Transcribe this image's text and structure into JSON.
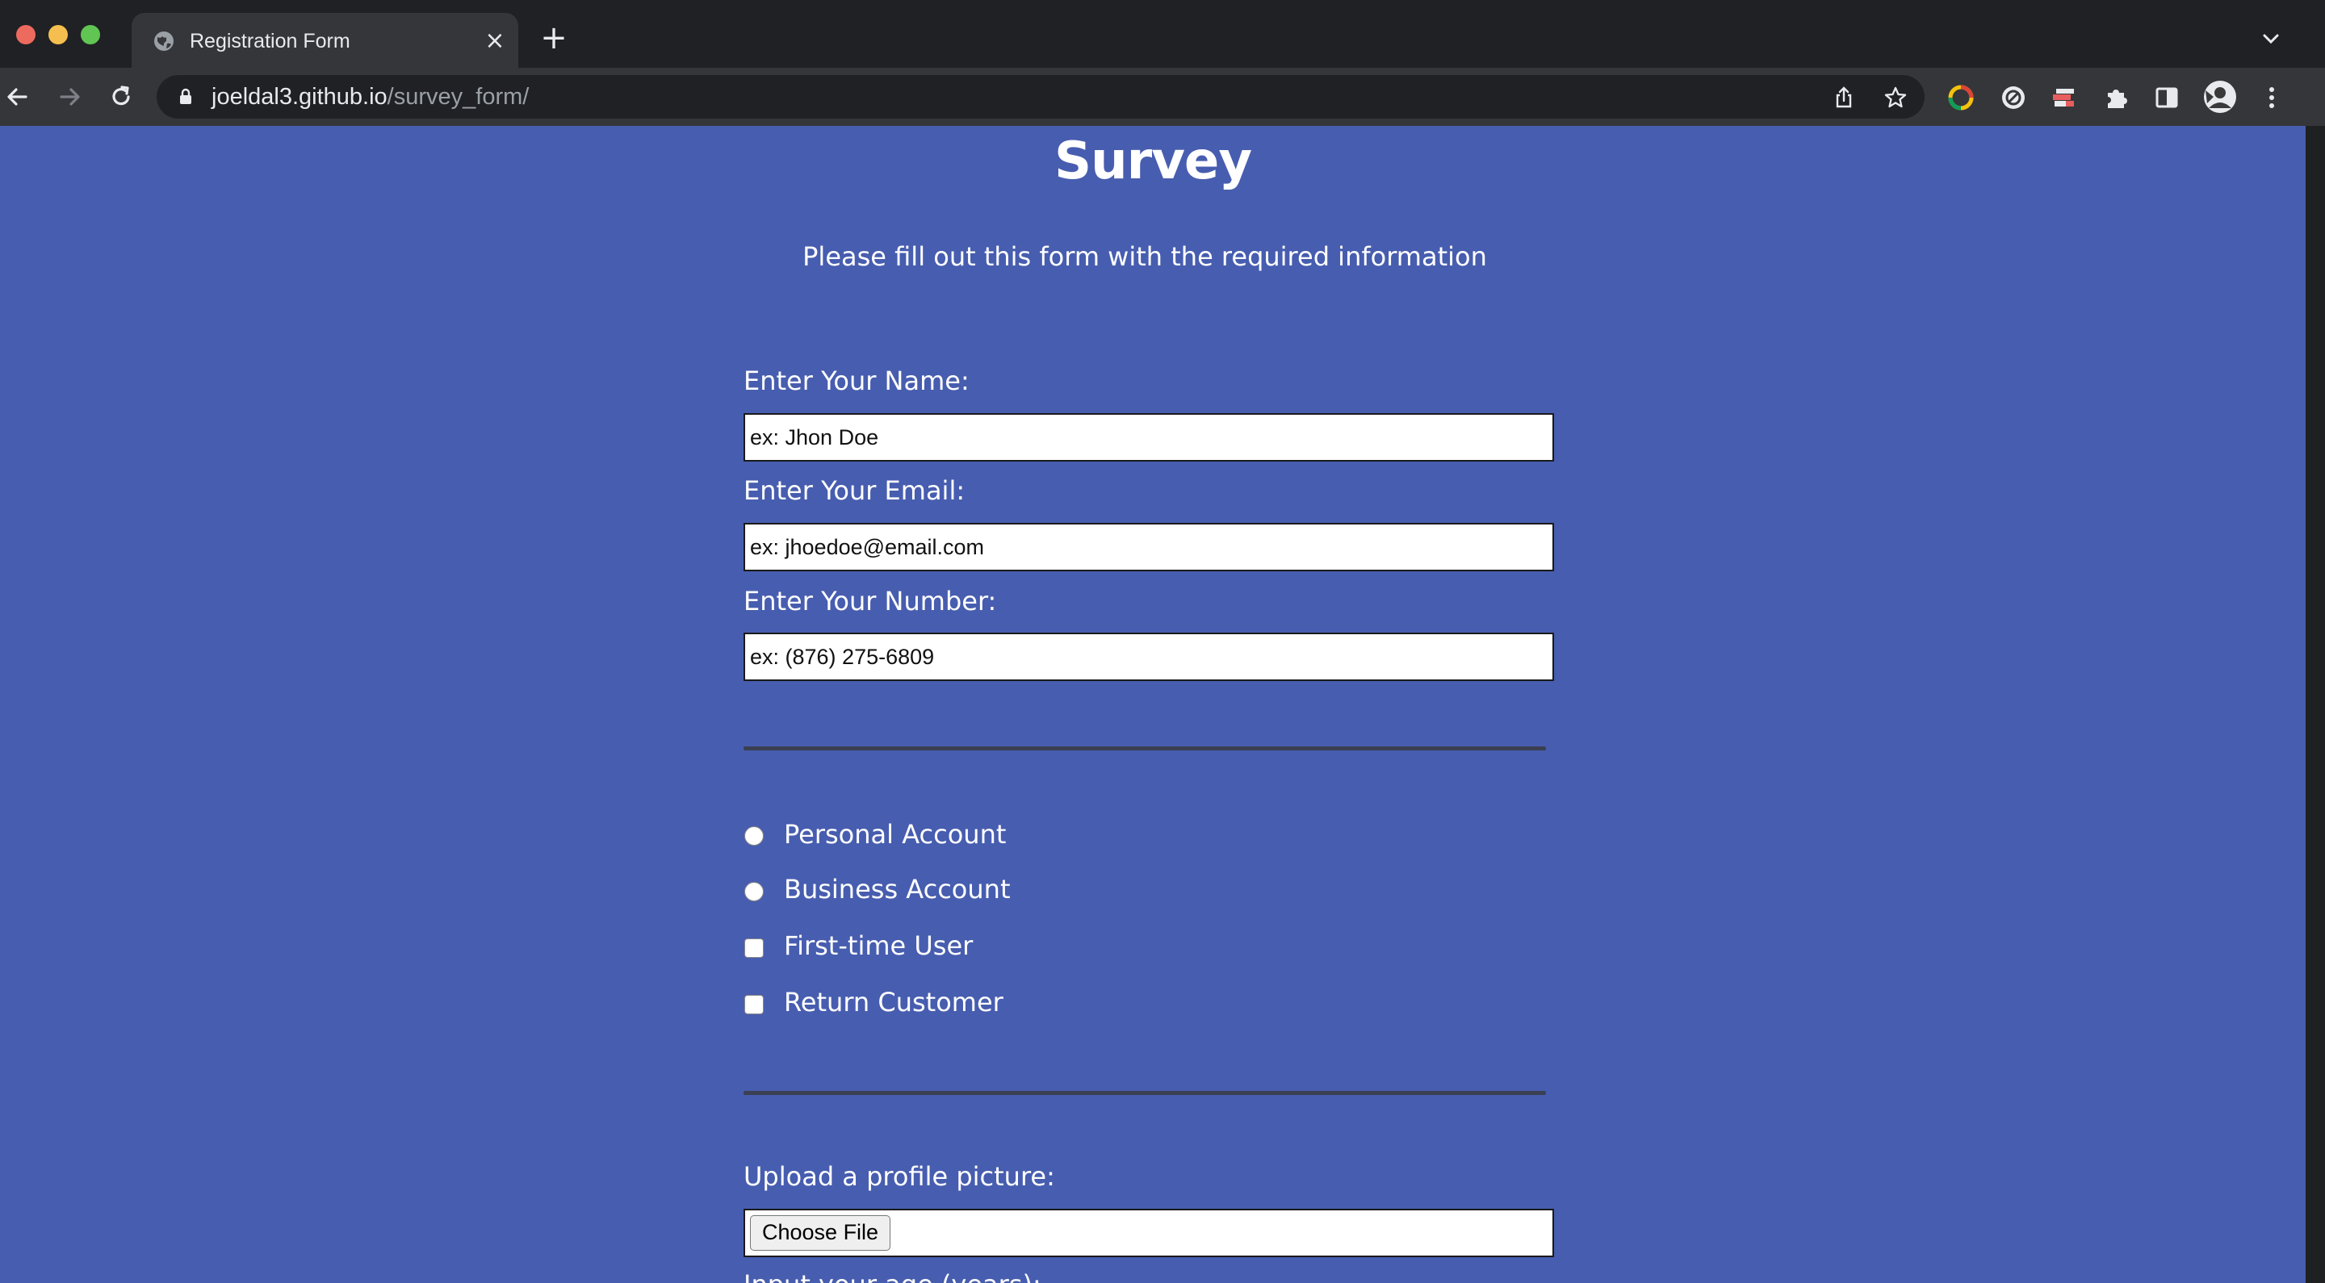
{
  "browser": {
    "tab_title": "Registration Form",
    "tab_close": "×",
    "new_tab": "+",
    "url_host": "joeldal3.github.io",
    "url_path": "/survey_form/"
  },
  "page": {
    "title": "Survey",
    "subtitle": "Please fill out this form with the required information",
    "name_label": "Enter Your Name:",
    "name_placeholder": "ex: Jhon Doe",
    "email_label": "Enter Your Email:",
    "email_placeholder": "ex: jhoedoe@email.com",
    "number_label": "Enter Your Number:",
    "number_placeholder": "ex: (876) 275-6809",
    "options": [
      {
        "label": "Personal Account",
        "type": "radio"
      },
      {
        "label": "Business Account",
        "type": "radio"
      },
      {
        "label": "First-time User",
        "type": "checkbox"
      },
      {
        "label": "Return Customer",
        "type": "checkbox"
      }
    ],
    "upload_label": "Upload a profile picture:",
    "choose_file": "Choose File",
    "cut_off_label": "Input your age (years):"
  },
  "colors": {
    "page_background": "#475daf",
    "chrome_dark": "#202124",
    "chrome_toolbar": "#35363a"
  }
}
